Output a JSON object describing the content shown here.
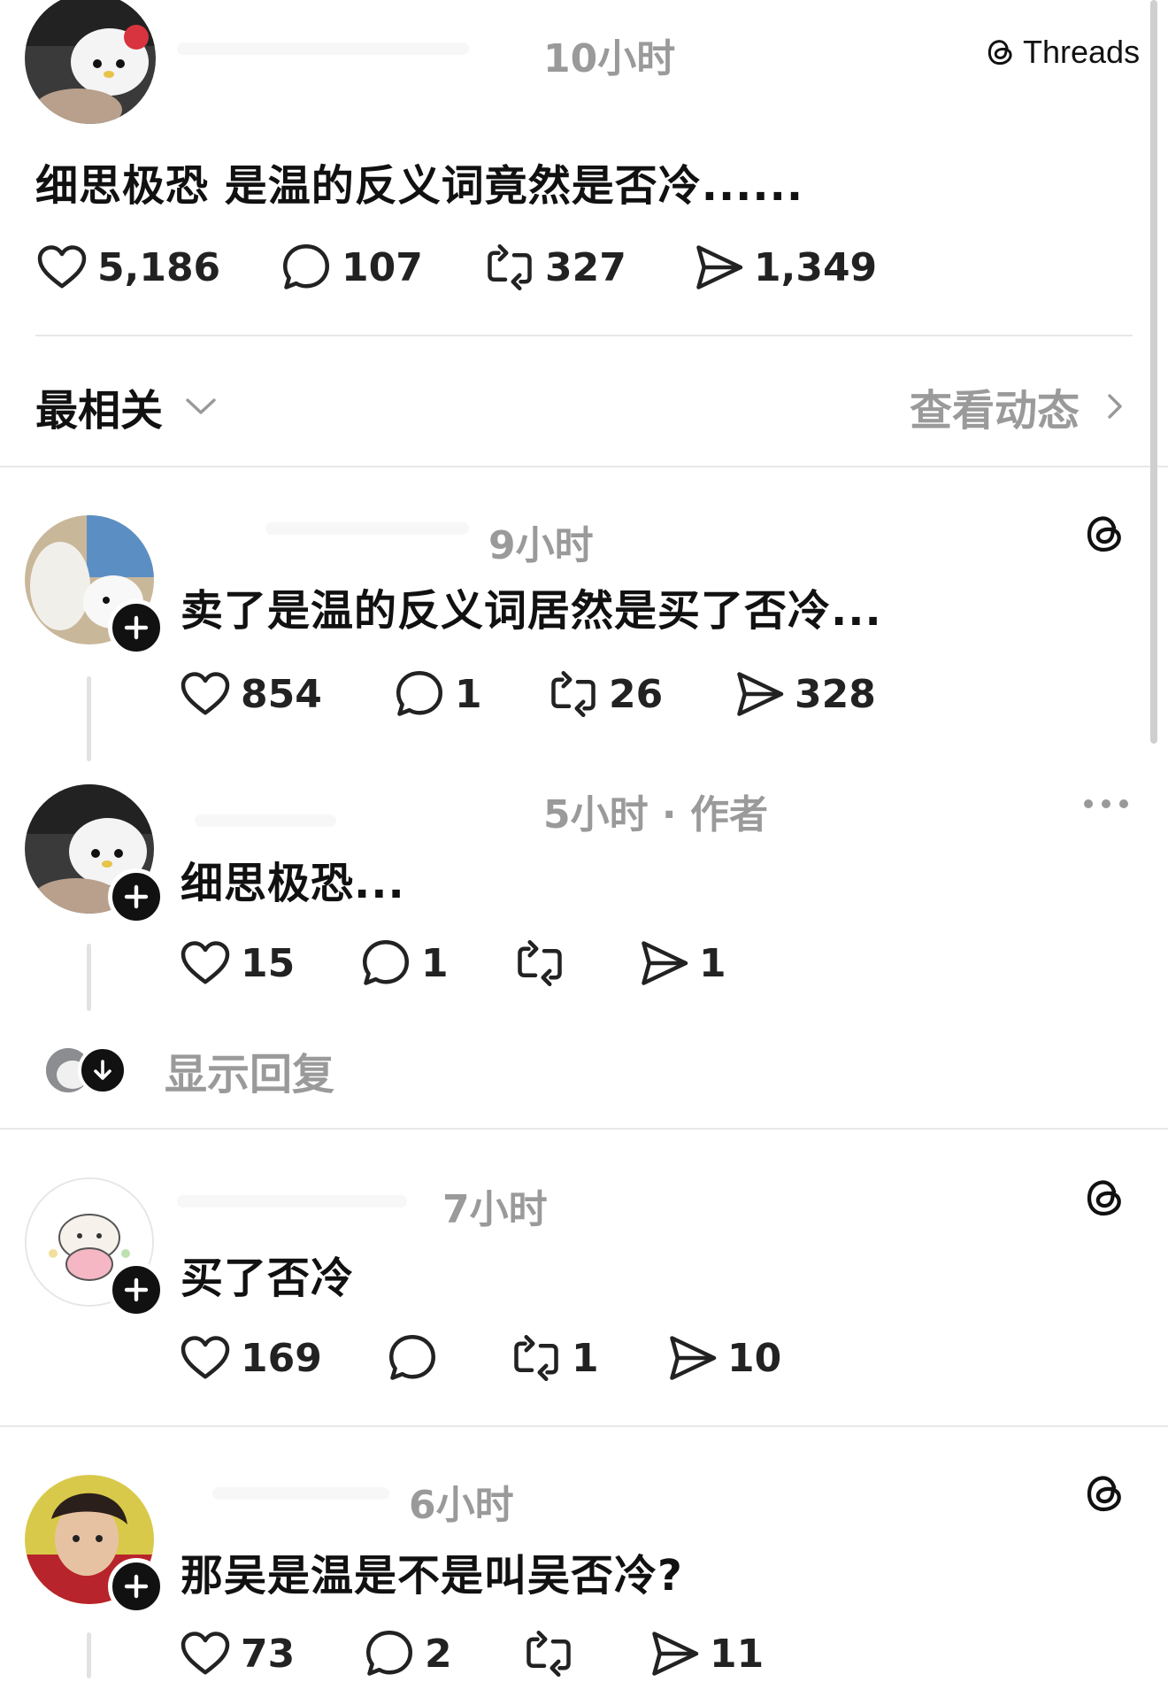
{
  "header": {
    "time": "10小时",
    "brand": "Threads"
  },
  "post": {
    "text": "细思极恐 是温的反义词竟然是否冷......",
    "likes": "5,186",
    "replies": "107",
    "reposts": "327",
    "shares": "1,349"
  },
  "sort_bar": {
    "sort_label": "最相关",
    "activity_label": "查看动态"
  },
  "comments": [
    {
      "time": "9小时",
      "text": "卖了是温的反义词居然是买了否冷...",
      "likes": "854",
      "replies": "1",
      "reposts": "26",
      "shares": "328"
    },
    {
      "time": "5小时 · 作者",
      "text": "细思极恐...",
      "likes": "15",
      "replies": "1",
      "reposts": "",
      "shares": "1"
    },
    {
      "time": "7小时",
      "text": "买了否冷",
      "likes": "169",
      "replies": "",
      "reposts": "1",
      "shares": "10"
    },
    {
      "time": "6小时",
      "text": "那吴是温是不是叫吴否冷?",
      "likes": "73",
      "replies": "2",
      "reposts": "",
      "shares": "11"
    }
  ],
  "show_replies_label": "显示回复",
  "icons": {
    "like": "heart-icon",
    "reply": "speech-bubble-icon",
    "repost": "repost-icon",
    "share": "send-icon",
    "threads": "threads-logo-icon",
    "more": "more-dots-icon",
    "follow": "plus-icon"
  },
  "colors": {
    "text": "#111111",
    "muted": "#9a9a9a",
    "divider": "#e8e8e8"
  }
}
